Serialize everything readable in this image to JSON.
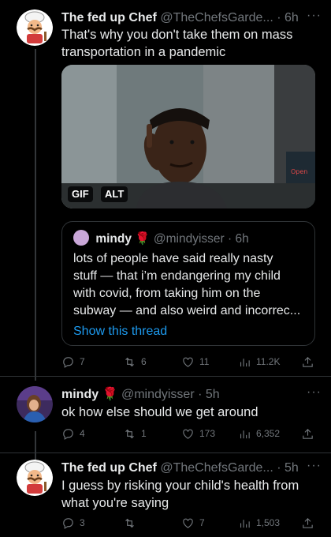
{
  "tweets": [
    {
      "author": "The fed up Chef",
      "handle": "@TheChefsGarde...",
      "time": "· 6h",
      "text_lines": [
        "That's why you don't take them on mass",
        "transportation in a pandemic"
      ],
      "media_badges": {
        "gif": "GIF",
        "alt": "ALT"
      },
      "quote": {
        "author": "mindy",
        "handle": "@mindyisser",
        "time": "· 6h",
        "text_lines": [
          "lots of people have said really nasty",
          "stuff — that i’m endangering my child",
          "with covid, from taking him on the",
          "subway — and also weird and incorrec..."
        ],
        "show_thread": "Show this thread"
      },
      "counts": {
        "replies": "7",
        "retweets": "6",
        "likes": "11",
        "views": "11.2K"
      }
    },
    {
      "author": "mindy",
      "handle": "@mindyisser",
      "time": "· 5h",
      "text_lines": [
        "ok how else should we get around"
      ],
      "counts": {
        "replies": "4",
        "retweets": "1",
        "likes": "173",
        "views": "6,352"
      }
    },
    {
      "author": "The fed up Chef",
      "handle": "@TheChefsGarde...",
      "time": "· 5h",
      "text_lines": [
        "I guess by risking your child's health from",
        "what you're saying"
      ],
      "counts": {
        "replies": "3",
        "retweets": "",
        "likes": "7",
        "views": "1,503"
      }
    }
  ],
  "more_label": "···",
  "colors": {
    "background": "#000000",
    "text": "#e7e9ea",
    "muted": "#71767b",
    "link": "#1d9bf0",
    "border": "#2f3336"
  },
  "icons": [
    "chef-avatar",
    "reply-icon",
    "retweet-icon",
    "like-icon",
    "views-icon",
    "share-icon",
    "rose-emoji"
  ]
}
